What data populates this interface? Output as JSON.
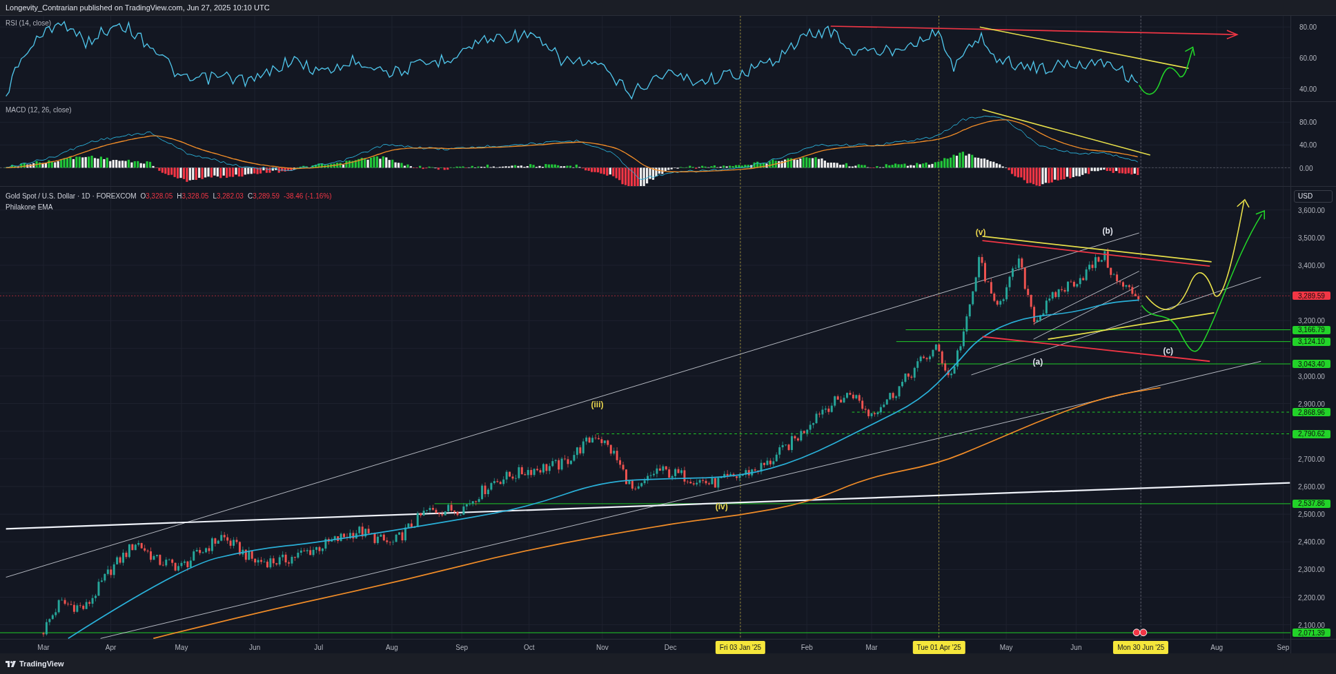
{
  "header": {
    "text": "Longevity_Contrarian published on TradingView.com, Jun 27, 2025 10:10 UTC"
  },
  "rsi_pane": {
    "title": "RSI (14, close)",
    "axis_labels": [
      "80.00",
      "60.00",
      "40.00"
    ]
  },
  "macd_pane": {
    "title": "MACD (12, 26, close)",
    "axis_labels": [
      "80.00",
      "40.00",
      "0.00"
    ]
  },
  "price_pane": {
    "symbol": "Gold Spot / U.S. Dollar · 1D · FOREXCOM",
    "ohlc": [
      {
        "label": "O",
        "value": "3,328.05"
      },
      {
        "label": "H",
        "value": "3,328.05"
      },
      {
        "label": "L",
        "value": "3,282.03"
      },
      {
        "label": "C",
        "value": "3,289.59"
      }
    ],
    "change": "-38.46 (-1.16%)",
    "indicator": "Philakone EMA",
    "currency": "USD",
    "wave_labels": [
      {
        "text": "(iii)",
        "color": "#e8d44d"
      },
      {
        "text": "(iv)",
        "color": "#e8d44d"
      },
      {
        "text": "(v)",
        "color": "#e8d44d"
      },
      {
        "text": "(b)",
        "color": "#e0e3eb"
      },
      {
        "text": "(a)",
        "color": "#e0e3eb"
      },
      {
        "text": "(c)",
        "color": "#e0e3eb"
      }
    ],
    "axis_labels": [
      {
        "text": "3,600.00",
        "kind": "tick"
      },
      {
        "text": "3,500.00",
        "kind": "tick"
      },
      {
        "text": "3,400.00",
        "kind": "tick"
      },
      {
        "text": "3,289.59",
        "kind": "tag",
        "color": "#f23645"
      },
      {
        "text": "3,200.00",
        "kind": "tick"
      },
      {
        "text": "3,166.79",
        "kind": "tag",
        "color": "#22d329"
      },
      {
        "text": "3,124.10",
        "kind": "tag",
        "color": "#22d329"
      },
      {
        "text": "3,043.40",
        "kind": "tag",
        "color": "#22d329"
      },
      {
        "text": "3,000.00",
        "kind": "tick"
      },
      {
        "text": "2,900.00",
        "kind": "tick"
      },
      {
        "text": "2,868.96",
        "kind": "tag",
        "color": "#22d329"
      },
      {
        "text": "2,790.62",
        "kind": "tag",
        "color": "#22d329"
      },
      {
        "text": "2,700.00",
        "kind": "tick"
      },
      {
        "text": "2,600.00",
        "kind": "tick"
      },
      {
        "text": "2,537.86",
        "kind": "tag",
        "color": "#22d329"
      },
      {
        "text": "2,500.00",
        "kind": "tick"
      },
      {
        "text": "2,400.00",
        "kind": "tick"
      },
      {
        "text": "2,300.00",
        "kind": "tick"
      },
      {
        "text": "2,200.00",
        "kind": "tick"
      },
      {
        "text": "2,100.00",
        "kind": "tick"
      },
      {
        "text": "2,071.39",
        "kind": "tag",
        "color": "#22d329"
      }
    ]
  },
  "time_axis": [
    {
      "text": "Mar",
      "kind": "month"
    },
    {
      "text": "Apr",
      "kind": "month"
    },
    {
      "text": "May",
      "kind": "month"
    },
    {
      "text": "Jun",
      "kind": "month"
    },
    {
      "text": "Jul",
      "kind": "month"
    },
    {
      "text": "Aug",
      "kind": "month"
    },
    {
      "text": "Sep",
      "kind": "month"
    },
    {
      "text": "Oct",
      "kind": "month"
    },
    {
      "text": "Nov",
      "kind": "month"
    },
    {
      "text": "Dec",
      "kind": "month"
    },
    {
      "text": "Fri 03 Jan '25",
      "kind": "marker"
    },
    {
      "text": "Feb",
      "kind": "month"
    },
    {
      "text": "Mar",
      "kind": "month"
    },
    {
      "text": "Tue 01 Apr '25",
      "kind": "marker"
    },
    {
      "text": "May",
      "kind": "month"
    },
    {
      "text": "Jun",
      "kind": "month"
    },
    {
      "text": "Mon 30 Jun '25",
      "kind": "marker"
    },
    {
      "text": "Aug",
      "kind": "month"
    },
    {
      "text": "Sep",
      "kind": "month"
    }
  ],
  "footer": {
    "brand": "TradingView"
  }
}
